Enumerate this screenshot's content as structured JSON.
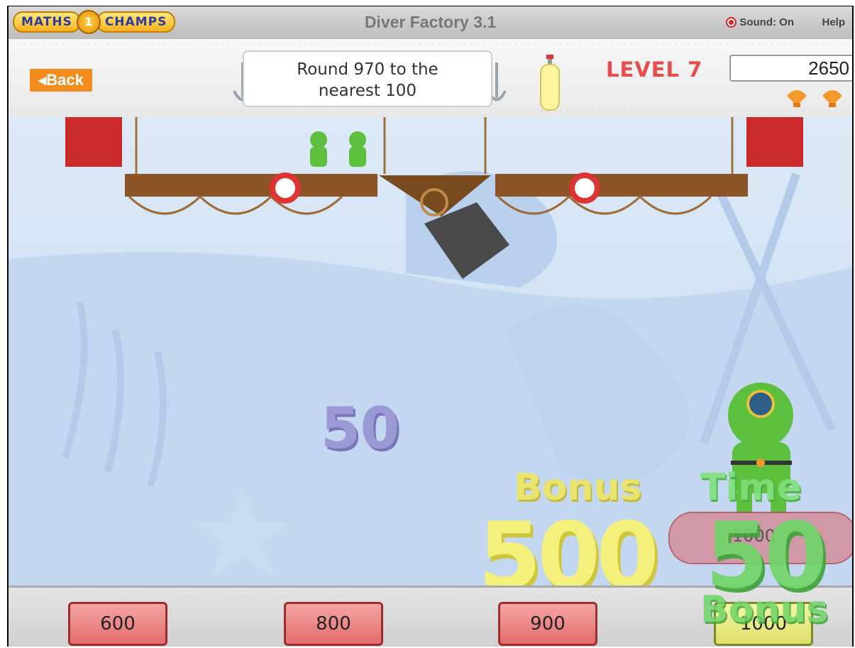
{
  "header": {
    "logo_left": "MATHS",
    "logo_right": "CHAMPS",
    "title": "Diver Factory 3.1",
    "sound_label": "Sound: On",
    "help_label": "Help"
  },
  "question_bar": {
    "back_label": "Back",
    "question_line1": "Round 970 to the",
    "question_line2": "nearest 100",
    "level_label": "LEVEL 7",
    "score": "2650",
    "shells": 2
  },
  "play_area": {
    "points_popup": "50",
    "bonus_label": "Bonus",
    "bonus_value": "500",
    "time_label": "Time",
    "time_value": "50",
    "time_bonus_label": "Bonus",
    "slot_text": "1000"
  },
  "answers": [
    {
      "label": "600"
    },
    {
      "label": "800"
    },
    {
      "label": "900"
    },
    {
      "label": "1000"
    }
  ],
  "colors": {
    "back_button": "#f28c1c",
    "level_text": "#e84c4c",
    "answer_button": "#e46d6d",
    "answer_correct": "#dfe06a",
    "sea": "#cfe1f4"
  }
}
